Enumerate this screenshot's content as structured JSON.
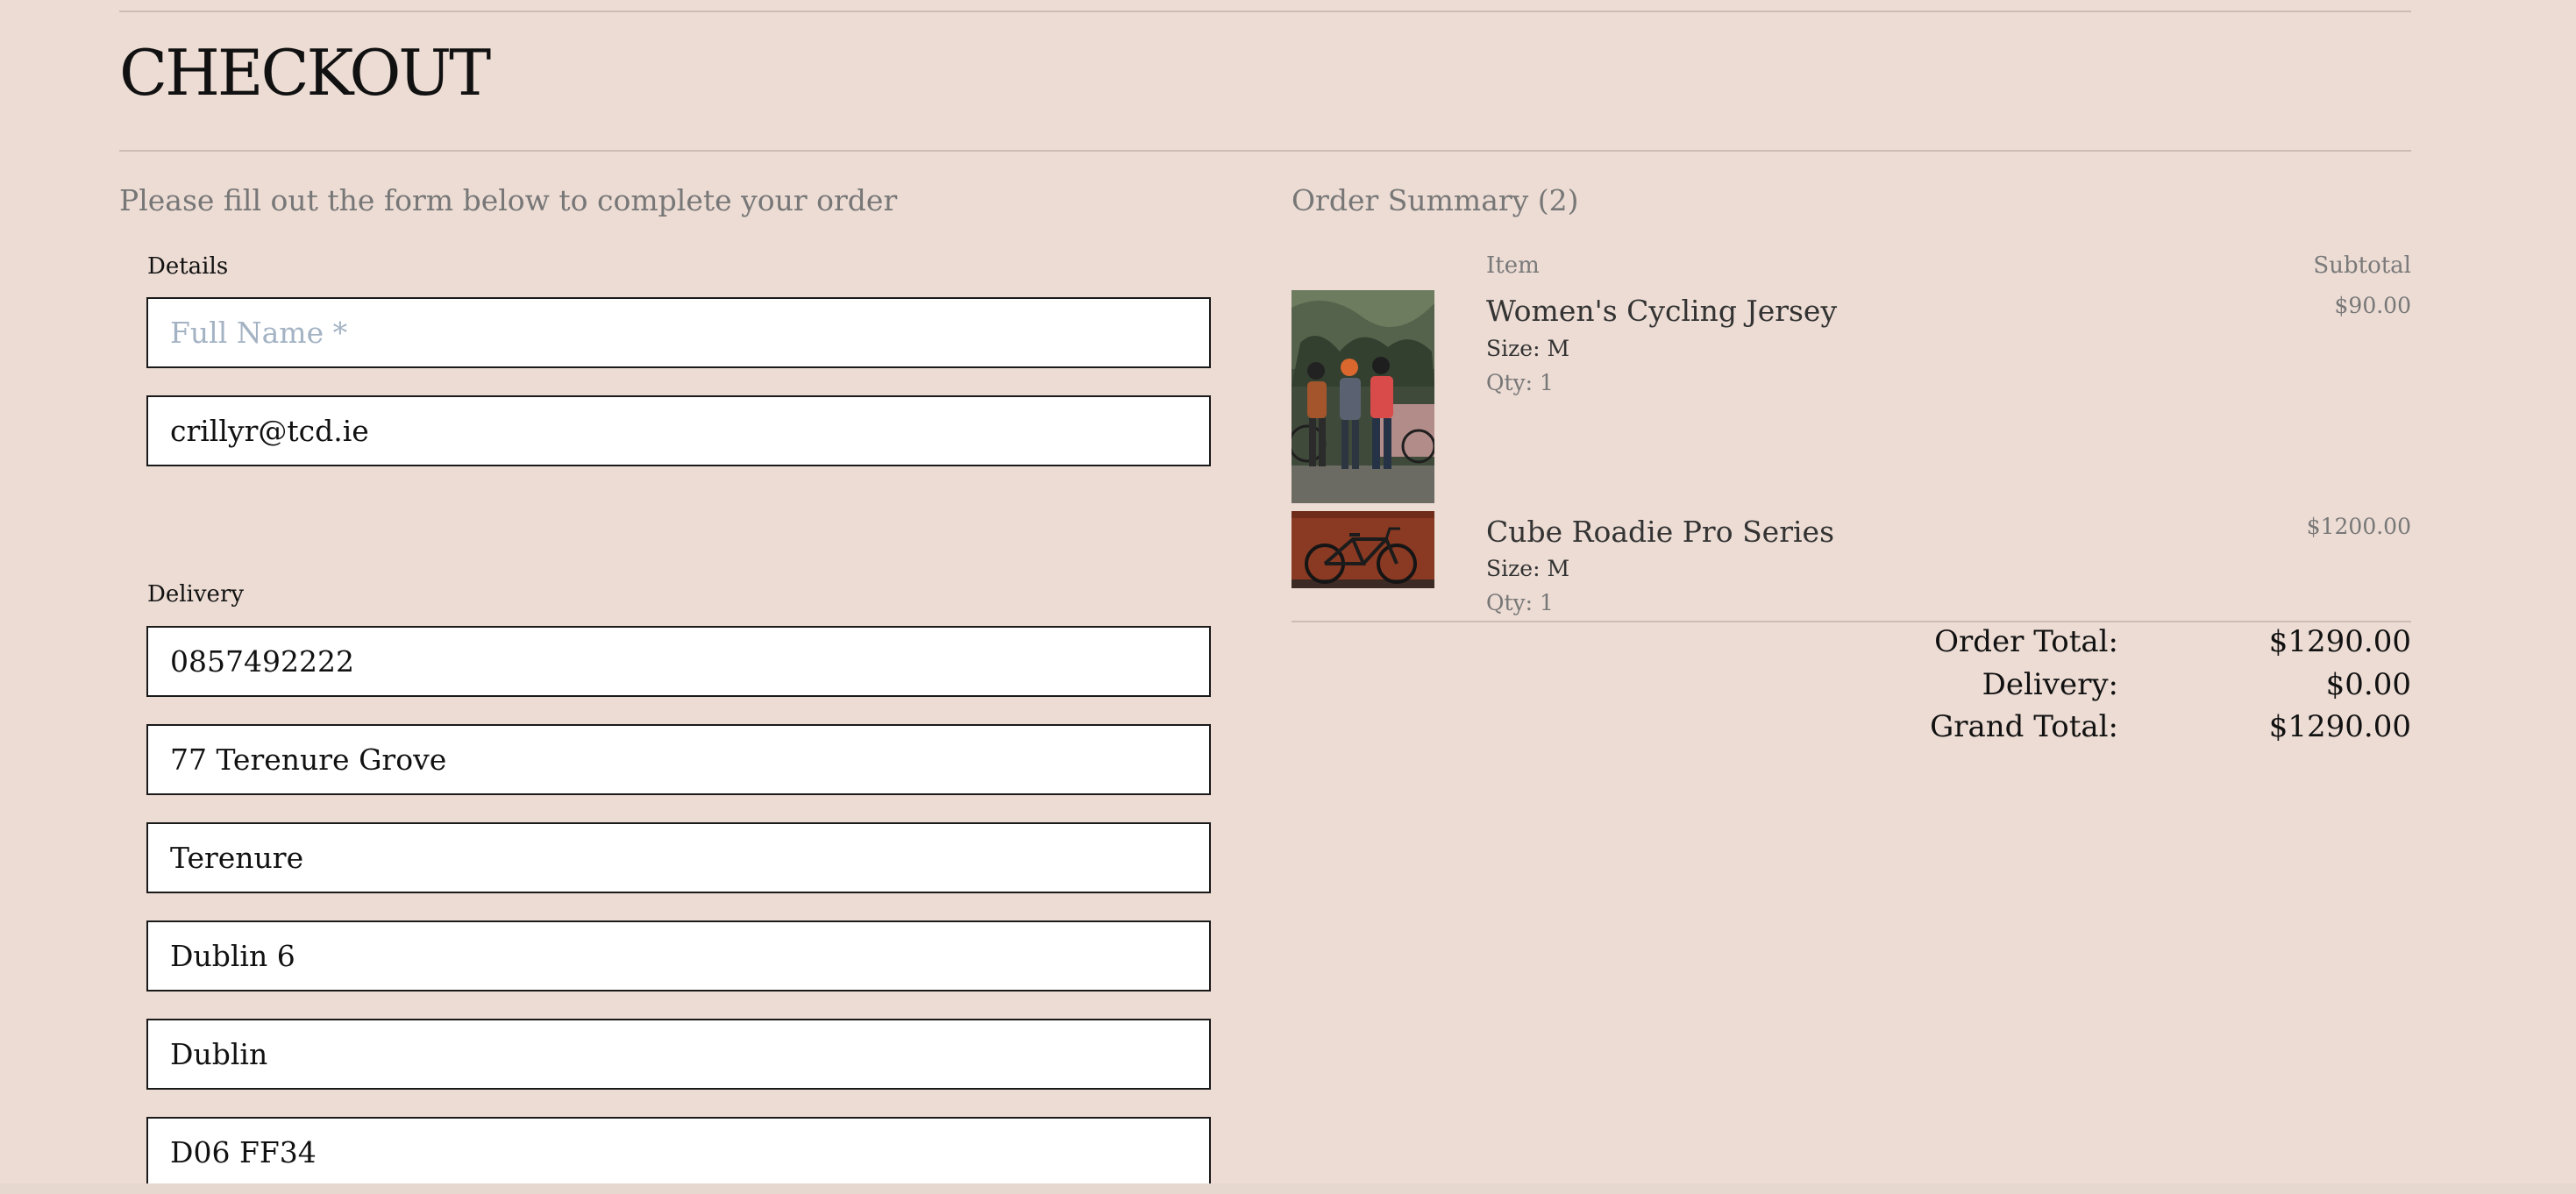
{
  "page": {
    "title": "CHECKOUT"
  },
  "form": {
    "intro": "Please fill out the form below to complete your order",
    "details_label": "Details",
    "full_name": {
      "value": "",
      "placeholder": "Full Name *"
    },
    "email": {
      "value": "crillyr@tcd.ie",
      "placeholder": ""
    },
    "delivery_label": "Delivery",
    "phone": {
      "value": "0857492222",
      "placeholder": ""
    },
    "address_line_1": {
      "value": "77 Terenure Grove",
      "placeholder": ""
    },
    "address_line_2": {
      "value": "Terenure",
      "placeholder": ""
    },
    "town": {
      "value": "Dublin 6",
      "placeholder": ""
    },
    "county": {
      "value": "Dublin",
      "placeholder": ""
    },
    "postcode": {
      "value": "D06 FF34",
      "placeholder": ""
    }
  },
  "summary": {
    "heading": "Order Summary (2)",
    "item_column": "Item",
    "subtotal_column": "Subtotal",
    "items": [
      {
        "name": "Women's Cycling Jersey",
        "size": "Size: M",
        "qty": "Qty: 1",
        "price": "$90.00",
        "image": "cyclists-photo"
      },
      {
        "name": "Cube Roadie Pro Series",
        "size": "Size: M",
        "qty": "Qty: 1",
        "price": "$1200.00",
        "image": "road-bike-photo"
      }
    ],
    "totals": {
      "order_total_label": "Order Total:",
      "order_total": "$1290.00",
      "delivery_label": "Delivery:",
      "delivery": "$0.00",
      "grand_total_label": "Grand Total:",
      "grand_total": "$1290.00"
    }
  },
  "colors": {
    "background": "#ecdcd4",
    "rule": "#cdbcb4",
    "muted_text": "#777777",
    "placeholder": "#a4b3c4"
  }
}
